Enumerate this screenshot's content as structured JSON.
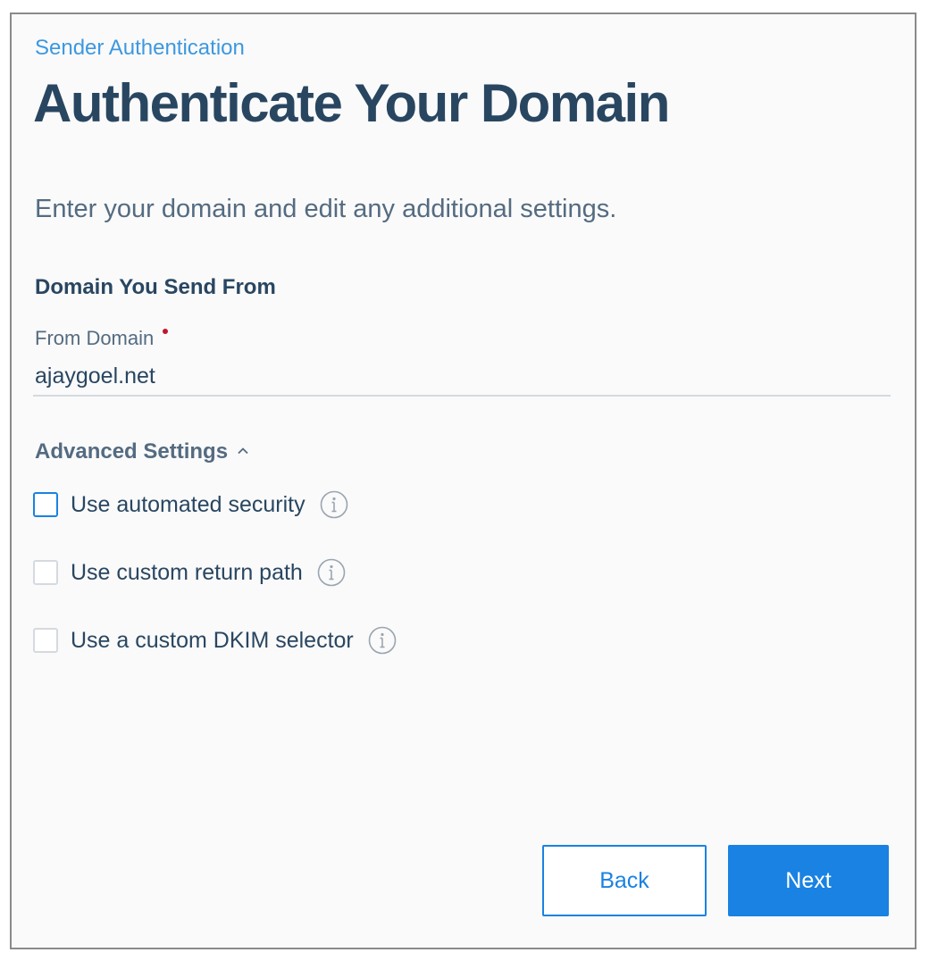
{
  "breadcrumb": "Sender Authentication",
  "title": "Authenticate Your Domain",
  "subtitle": "Enter your domain and edit any additional settings.",
  "domain_section": {
    "heading": "Domain You Send From",
    "field_label": "From Domain",
    "value": "ajaygoel.net"
  },
  "advanced": {
    "toggle_label": "Advanced Settings",
    "options": [
      {
        "label": "Use automated security",
        "checked": false
      },
      {
        "label": "Use custom return path",
        "checked": false
      },
      {
        "label": "Use a custom DKIM selector",
        "checked": false
      }
    ]
  },
  "buttons": {
    "back_label": "Back",
    "next_label": "Next"
  },
  "colors": {
    "accent": "#1a82e2",
    "heading": "#294661",
    "muted": "#546b81",
    "required": "#c0162e"
  }
}
